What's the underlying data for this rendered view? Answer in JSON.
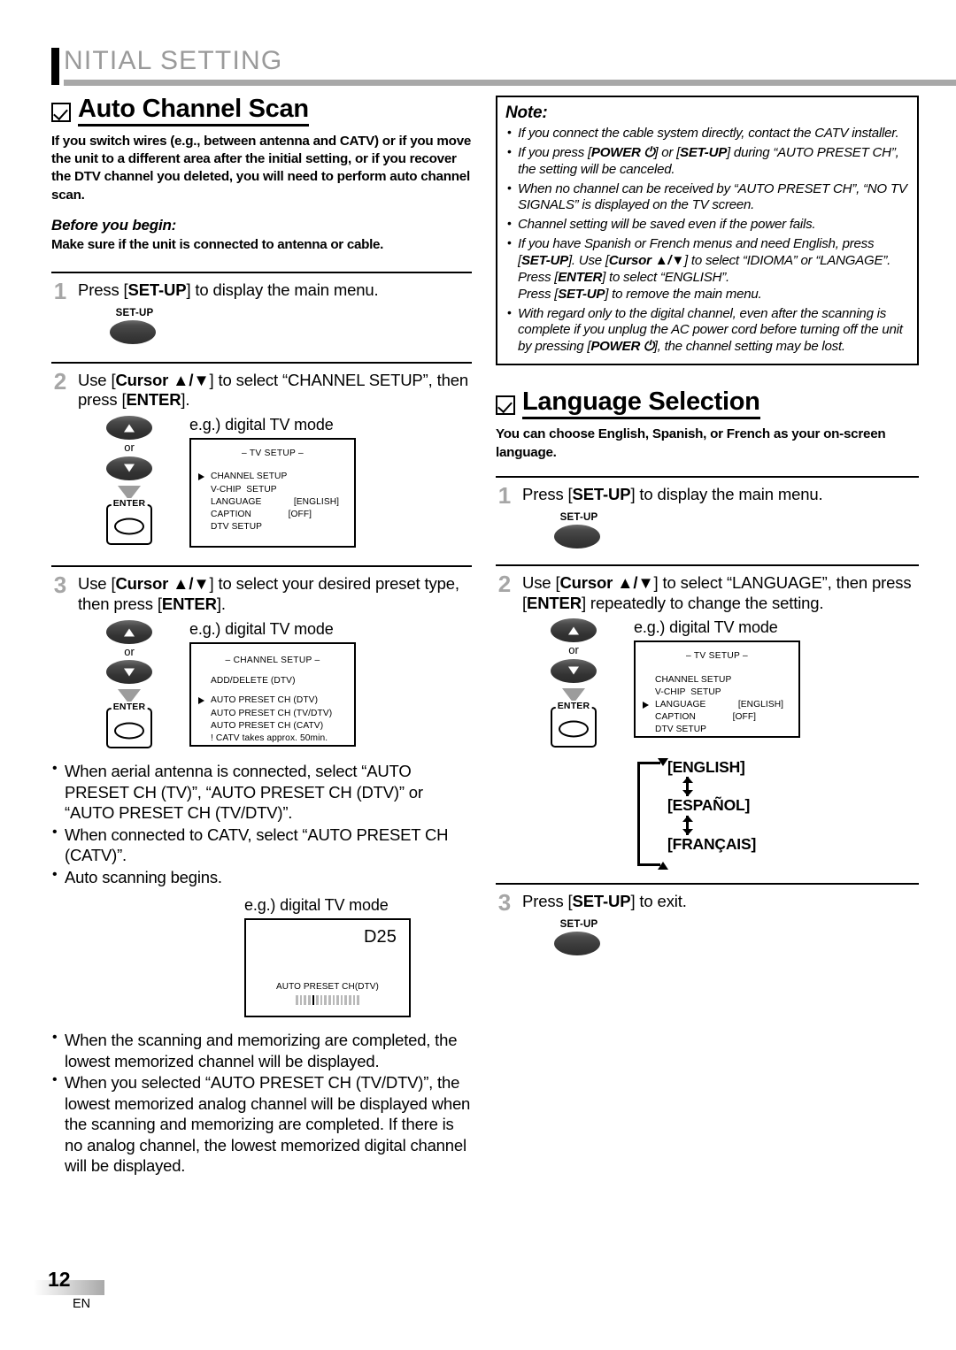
{
  "header": {
    "bar_letter": "I",
    "title": "NITIAL  SETTING"
  },
  "footer": {
    "page_number": "12",
    "language_code": "EN"
  },
  "icons": {
    "checkbox": "checkbox-checked-icon",
    "setup_button": "setup-button-icon",
    "cursor_up": "cursor-up-icon",
    "cursor_down": "cursor-down-icon",
    "enter_button": "enter-button-icon",
    "flow_arrow": "down-arrow-icon"
  },
  "common": {
    "or": "or",
    "setup_label": "SET-UP",
    "enter_label": "ENTER",
    "eg_digital": "e.g.) digital TV mode"
  },
  "auto_channel_scan": {
    "title": "Auto Channel Scan",
    "intro": "If you switch wires (e.g., between antenna and CATV) or if you move the unit to a different area after the initial setting, or if you recover the DTV channel you deleted, you will need to perform auto channel scan.",
    "before_heading": "Before you begin:",
    "before_text": "Make sure if the unit is connected to antenna or cable.",
    "steps": [
      {
        "num": "1",
        "text_html": "Press [<b>SET-UP</b>] to display the main menu."
      },
      {
        "num": "2",
        "text_html": "Use [<b>Cursor ▲/▼</b>] to select “CHANNEL SETUP”, then press [<b>ENTER</b>]."
      },
      {
        "num": "3",
        "text_html": "Use [<b>Cursor ▲/▼</b>] to select your desired preset type, then press [<b>ENTER</b>]."
      }
    ],
    "tv_setup_screen": {
      "title": "– TV SETUP –",
      "rows": [
        {
          "label": "CHANNEL SETUP",
          "value": "",
          "selected": true
        },
        {
          "label": "V-CHIP  SETUP",
          "value": "",
          "selected": false
        },
        {
          "label": "LANGUAGE",
          "value": "[ENGLISH]",
          "selected": false
        },
        {
          "label": "CAPTION",
          "value": "[OFF]",
          "selected": false
        },
        {
          "label": "DTV SETUP",
          "value": "",
          "selected": false
        }
      ]
    },
    "channel_setup_screen": {
      "title": "– CHANNEL SETUP –",
      "first_row": "ADD/DELETE (DTV)",
      "rows": [
        {
          "label": "AUTO PRESET CH (DTV)",
          "selected": true
        },
        {
          "label": "AUTO PRESET CH (TV/DTV)",
          "selected": false
        },
        {
          "label": "AUTO PRESET CH (CATV)",
          "selected": false
        },
        {
          "label": "! CATV takes approx. 50min.",
          "selected": false
        }
      ]
    },
    "bullets_mid": [
      "When aerial antenna is connected, select “AUTO PRESET CH (TV)”, “AUTO PRESET CH (DTV)” or “AUTO PRESET CH (TV/DTV)”.",
      "When connected to CATV, select “AUTO PRESET CH (CATV)”.",
      "Auto scanning begins."
    ],
    "scan_screen": {
      "channel": "D25",
      "status": "AUTO PRESET CH(DTV)",
      "progress_total": 16,
      "progress_active_index": 4
    },
    "bullets_end": [
      "When the scanning and memorizing are completed, the lowest memorized channel will be displayed.",
      "When you selected “AUTO PRESET CH (TV/DTV)”, the lowest memorized analog channel will be displayed when the scanning and memorizing are completed. If there is no analog channel, the lowest memorized digital channel will be displayed."
    ]
  },
  "note": {
    "title": "Note:",
    "items_html": [
      "If you connect the cable system directly, contact the CATV installer.",
      "If you press [<b>POWER ⏻</b>] or [<b>SET-UP</b>] during “AUTO PRESET CH”, the setting will be canceled.",
      "When no channel can be received by “AUTO PRESET CH”, “NO TV SIGNALS” is displayed on the TV screen.",
      "Channel setting will be saved even if the power fails.",
      "If you have Spanish or French menus and need English, press [<b>SET-UP</b>]. Use [<b>Cursor ▲/▼</b>] to select “IDIOMA” or “LANGAGE”. Press [<b>ENTER</b>] to select “ENGLISH”.<br>Press [<b>SET-UP</b>] to remove the main menu.",
      "With regard only to the digital channel, even after the scanning is complete if you unplug the AC power cord before turning off the unit by pressing [<b>POWER ⏻</b>], the channel setting may be lost."
    ]
  },
  "language_selection": {
    "title": "Language Selection",
    "intro": "You can choose English, Spanish, or French as your on-screen language.",
    "steps": [
      {
        "num": "1",
        "text_html": "Press [<b>SET-UP</b>] to display the main menu."
      },
      {
        "num": "2",
        "text_html": "Use [<b>Cursor ▲/▼</b>] to select “LANGUAGE”, then press [<b>ENTER</b>] repeatedly to change the setting."
      },
      {
        "num": "3",
        "text_html": "Press [<b>SET-UP</b>] to exit."
      }
    ],
    "tv_setup_screen": {
      "title": "– TV SETUP –",
      "rows": [
        {
          "label": "CHANNEL SETUP",
          "value": "",
          "selected": false
        },
        {
          "label": "V-CHIP  SETUP",
          "value": "",
          "selected": false
        },
        {
          "label": "LANGUAGE",
          "value": "[ENGLISH]",
          "selected": true
        },
        {
          "label": "CAPTION",
          "value": "[OFF]",
          "selected": false
        },
        {
          "label": "DTV SETUP",
          "value": "",
          "selected": false
        }
      ]
    },
    "language_cycle": [
      "[ENGLISH]",
      "[ESPAÑOL]",
      "[FRANÇAIS]"
    ]
  }
}
